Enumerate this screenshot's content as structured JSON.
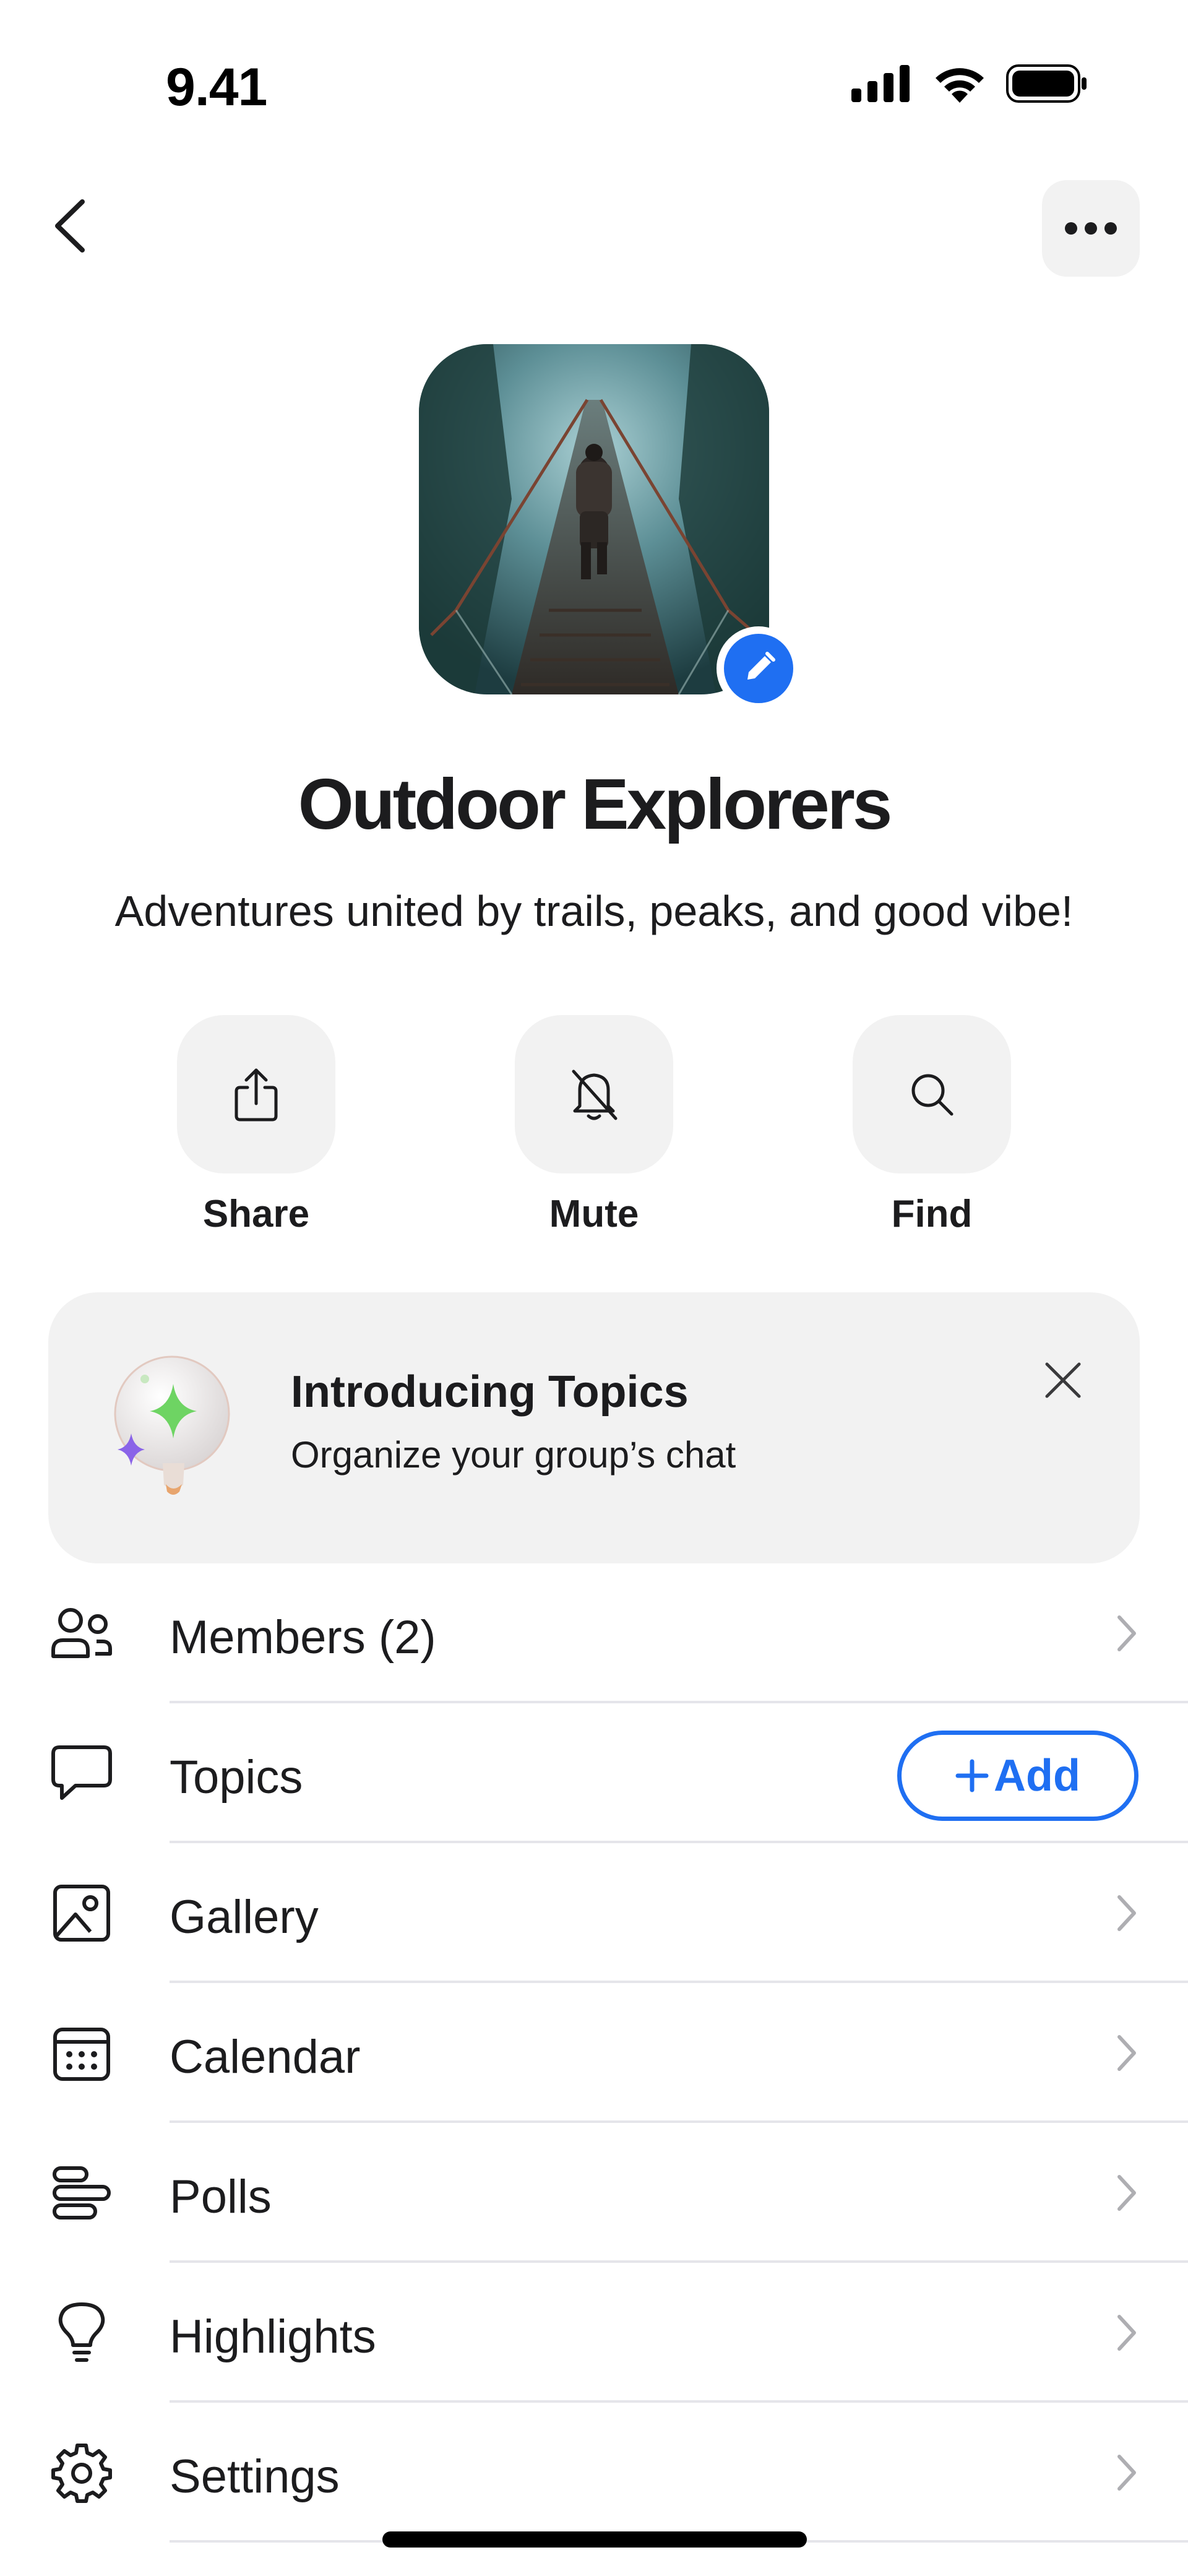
{
  "status_bar": {
    "time": "9.41"
  },
  "group": {
    "title": "Outdoor Explorers",
    "description": "Adventures united by trails, peaks, and good vibe!"
  },
  "actions": [
    {
      "label": "Share",
      "icon": "share-icon"
    },
    {
      "label": "Mute",
      "icon": "bell-slash-icon"
    },
    {
      "label": "Find",
      "icon": "search-icon"
    }
  ],
  "promo": {
    "title": "Introducing Topics",
    "subtitle": "Organize your group’s chat",
    "icon": "sparkle-lightbulb-icon"
  },
  "list": {
    "members": "Members (2)",
    "topics": "Topics",
    "topics_add": "Add",
    "gallery": "Gallery",
    "calendar": "Calendar",
    "polls": "Polls",
    "highlights": "Highlights",
    "settings": "Settings"
  },
  "colors": {
    "accent": "#1f6ff2",
    "surface": "#f2f2f2",
    "divider": "#e5e5ea"
  }
}
